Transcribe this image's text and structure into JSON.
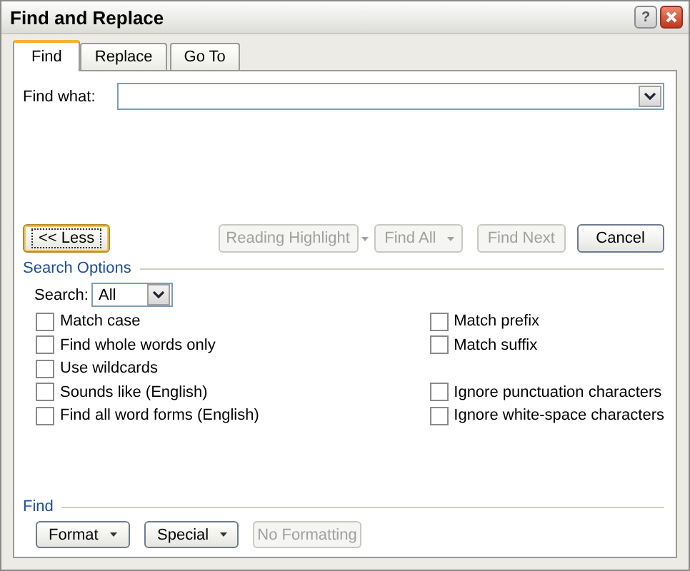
{
  "window": {
    "title": "Find and Replace",
    "help_button": "?"
  },
  "tabs": [
    {
      "label": "Find",
      "selected": true
    },
    {
      "label": "Replace",
      "selected": false
    },
    {
      "label": "Go To",
      "selected": false
    }
  ],
  "find_what": {
    "label": "Find what:"
  },
  "actions": [
    {
      "label": "<< Less",
      "kind": "button",
      "disabled": false,
      "focused": true
    },
    {
      "label": "Reading Highlight",
      "kind": "dropdown",
      "disabled": true,
      "focused": false
    },
    {
      "label": "Find All",
      "kind": "dropdown",
      "disabled": true,
      "focused": false
    },
    {
      "label": "Find Next",
      "kind": "button",
      "disabled": true,
      "focused": false
    },
    {
      "label": "Cancel",
      "kind": "button",
      "disabled": false,
      "focused": false
    }
  ],
  "search_options": {
    "title": "Search Options",
    "search_label": "Search:",
    "search_value": "All",
    "left": [
      {
        "label": "Match case",
        "checked": false
      },
      {
        "label": "Find whole words only",
        "checked": false
      },
      {
        "label": "Use wildcards",
        "checked": false
      },
      {
        "label": "Sounds like (English)",
        "checked": false
      },
      {
        "label": "Find all word forms (English)",
        "checked": false
      }
    ],
    "right": [
      {
        "label": "Match prefix",
        "checked": false
      },
      {
        "label": "Match suffix",
        "checked": false
      },
      {
        "label": "Ignore punctuation characters",
        "checked": false,
        "spaced": true
      },
      {
        "label": "Ignore white-space characters",
        "checked": false
      }
    ]
  },
  "find_section": {
    "title": "Find",
    "buttons": [
      {
        "label": "Format",
        "kind": "dropdown",
        "disabled": false
      },
      {
        "label": "Special",
        "kind": "dropdown",
        "disabled": false
      },
      {
        "label": "No Formatting",
        "kind": "button",
        "disabled": true
      }
    ]
  }
}
